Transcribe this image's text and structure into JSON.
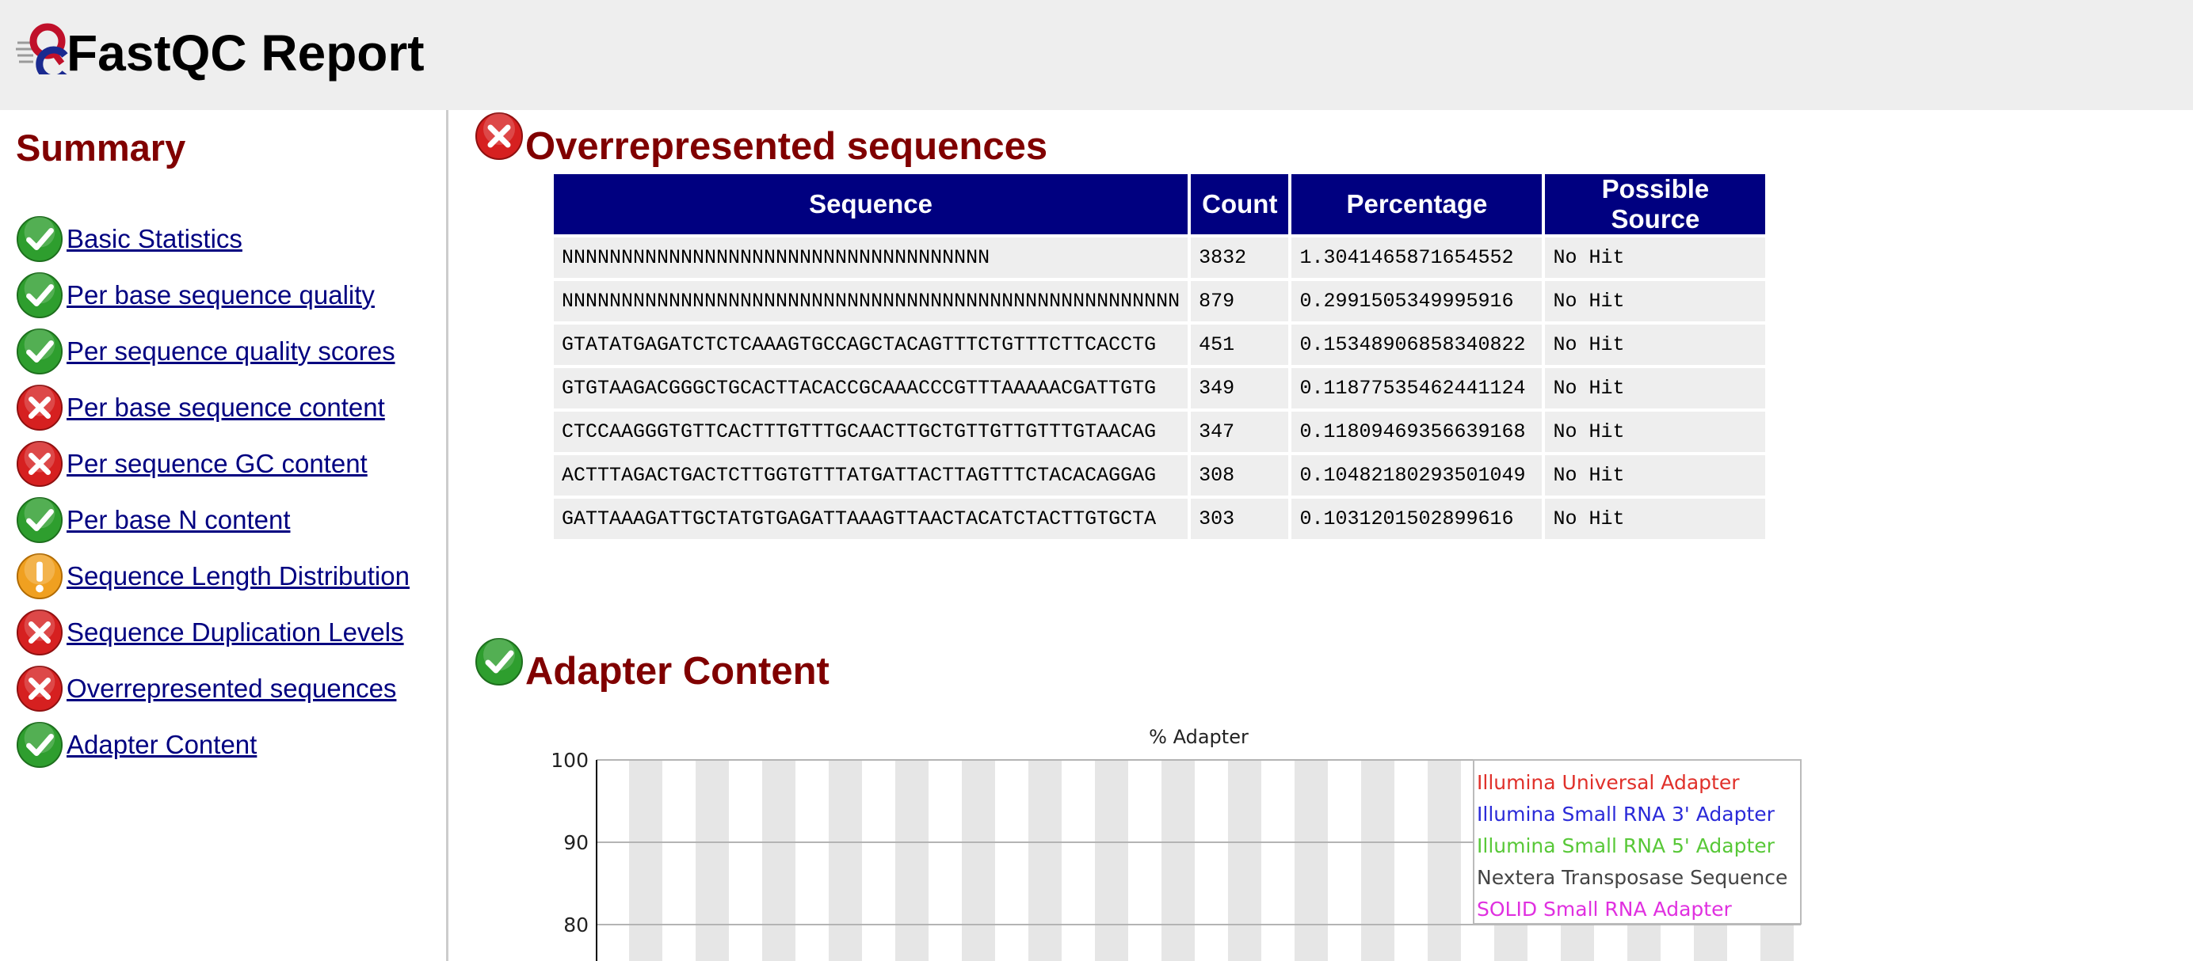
{
  "header": {
    "title": "FastQC Report",
    "logo_icon": "fastqc-logo-icon"
  },
  "sidebar": {
    "heading": "Summary",
    "items": [
      {
        "label": "Basic Statistics",
        "status": "pass"
      },
      {
        "label": "Per base sequence quality",
        "status": "pass"
      },
      {
        "label": "Per sequence quality scores",
        "status": "pass"
      },
      {
        "label": "Per base sequence content",
        "status": "fail"
      },
      {
        "label": "Per sequence GC content",
        "status": "fail"
      },
      {
        "label": "Per base N content",
        "status": "pass"
      },
      {
        "label": "Sequence Length Distribution",
        "status": "warn"
      },
      {
        "label": "Sequence Duplication Levels",
        "status": "fail"
      },
      {
        "label": "Overrepresented sequences",
        "status": "fail"
      },
      {
        "label": "Adapter Content",
        "status": "pass"
      }
    ]
  },
  "overrepresented": {
    "heading": "Overrepresented sequences",
    "status": "fail",
    "columns": [
      "Sequence",
      "Count",
      "Percentage",
      "Possible Source"
    ],
    "rows": [
      [
        "NNNNNNNNNNNNNNNNNNNNNNNNNNNNNNNNNNNN",
        "3832",
        "1.3041465871654552",
        "No Hit"
      ],
      [
        "NNNNNNNNNNNNNNNNNNNNNNNNNNNNNNNNNNNNNNNNNNNNNNNNNNNN",
        "879",
        "0.2991505349995916",
        "No Hit"
      ],
      [
        "GTATATGAGATCTCTCAAAGTGCCAGCTACAGTTTCTGTTTCTTCACCTG",
        "451",
        "0.15348906858340822",
        "No Hit"
      ],
      [
        "GTGTAAGACGGGCTGCACTTACACCGCAAACCCGTTTAAAAACGATTGTG",
        "349",
        "0.11877535462441124",
        "No Hit"
      ],
      [
        "CTCCAAGGGTGTTCACTTTGTTTGCAACTTGCTGTTGTTGTTTGTAACAG",
        "347",
        "0.11809469356639168",
        "No Hit"
      ],
      [
        "ACTTTAGACTGACTCTTGGTGTTTATGATTACTTAGTTTCTACACAGGAG",
        "308",
        "0.10482180293501049",
        "No Hit"
      ],
      [
        "GATTAAAGATTGCTATGTGAGATTAAAGTTAACTACATCTACTTGTGCTA",
        "303",
        "0.1031201502899616",
        "No Hit"
      ]
    ]
  },
  "adapter": {
    "heading": "Adapter Content",
    "status": "pass"
  },
  "colors": {
    "accent": "#800000",
    "link": "#000080",
    "table_header": "#000080",
    "pass": "#2e9e2e",
    "fail": "#d62020",
    "warn": "#f0a020"
  },
  "chart_data": {
    "type": "line",
    "title": "% Adapter",
    "ylim": [
      80,
      100
    ],
    "yticks": [
      100,
      90,
      80
    ],
    "grid": true,
    "legend_position": "top-right",
    "series": [
      {
        "name": "Illumina Universal Adapter",
        "color": "#e0302a",
        "values": []
      },
      {
        "name": "Illumina Small RNA 3' Adapter",
        "color": "#2a2ad8",
        "values": []
      },
      {
        "name": "Illumina Small RNA 5' Adapter",
        "color": "#58c838",
        "values": []
      },
      {
        "name": "Nextera Transposase Sequence",
        "color": "#444444",
        "values": []
      },
      {
        "name": "SOLID Small RNA Adapter",
        "color": "#e030e0",
        "values": []
      }
    ]
  }
}
